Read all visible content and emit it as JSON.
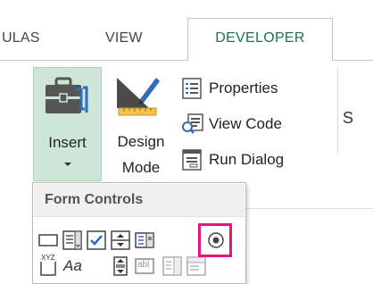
{
  "ribbon": {
    "tabs": [
      {
        "label": "ULAS",
        "active": false
      },
      {
        "label": "VIEW",
        "active": false
      },
      {
        "label": "DEVELOPER",
        "active": true
      }
    ],
    "accent_color": "#217346",
    "controls_group": {
      "insert_label": "Insert",
      "design_label_1": "Design",
      "design_label_2": "Mode",
      "properties_label": "Properties",
      "view_code_label": "View Code",
      "run_dialog_label": "Run Dialog",
      "cut_label": "S"
    }
  },
  "insert_menu": {
    "title": "Form Controls",
    "controls_row1": [
      "button-icon",
      "combo-box-icon",
      "check-box-icon",
      "spin-button-icon",
      "list-box-icon",
      "option-button-icon"
    ],
    "controls_row2": [
      "group-box-icon",
      "label-icon",
      "scroll-bar-icon",
      "text-field-icon",
      "combo-list-edit-icon",
      "combo-drop-down-edit-icon"
    ],
    "group_box_text": "XYZ",
    "label_text": "Aa",
    "text_field_text": "abl",
    "highlight_color": "#e5177e",
    "highlighted_control": "option-button-icon"
  }
}
